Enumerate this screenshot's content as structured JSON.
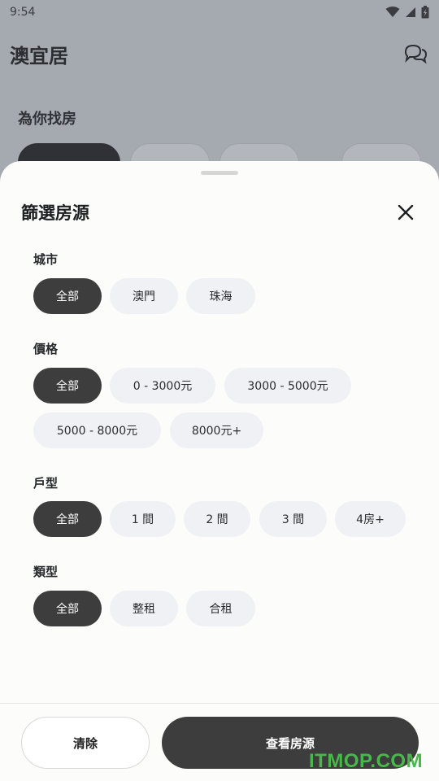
{
  "status_bar": {
    "time": "9:54"
  },
  "app": {
    "title": "澳宜居",
    "section_title": "為你找房"
  },
  "sheet": {
    "title": "篩選房源",
    "groups": [
      {
        "label": "城市",
        "options": [
          "全部",
          "澳門",
          "珠海"
        ],
        "selected": "全部"
      },
      {
        "label": "價格",
        "options": [
          "全部",
          "0 - 3000元",
          "3000 - 5000元",
          "5000 - 8000元",
          "8000元+"
        ],
        "selected": "全部"
      },
      {
        "label": "戶型",
        "options": [
          "全部",
          "1 間",
          "2 間",
          "3 間",
          "4房+"
        ],
        "selected": "全部"
      },
      {
        "label": "類型",
        "options": [
          "全部",
          "整租",
          "合租"
        ],
        "selected": "全部"
      }
    ],
    "clear_label": "清除",
    "view_label": "查看房源"
  },
  "watermark": "ITMOP.COM",
  "colors": {
    "accent_dark": "#3d3d3d",
    "chip_bg": "#eff1f4",
    "watermark": "#49b84a"
  }
}
